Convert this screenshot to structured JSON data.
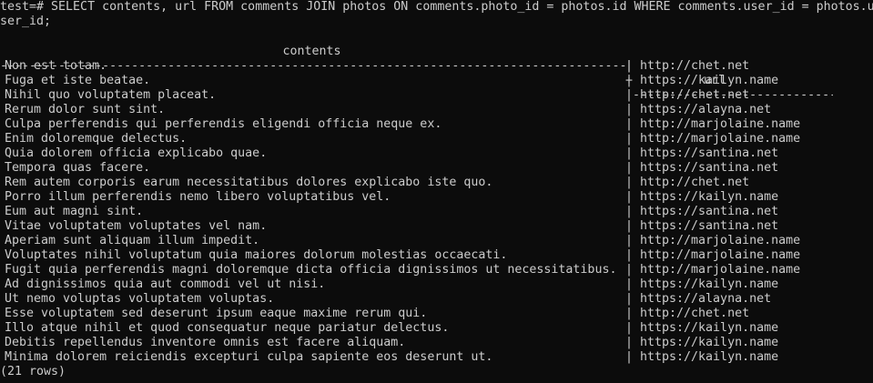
{
  "terminal": {
    "prompt_line_1": "test=# SELECT contents, url FROM comments JOIN photos ON comments.photo_id = photos.id WHERE comments.user_id = photos.u",
    "prompt_line_2": "ser_id;",
    "header": {
      "col1": "contents",
      "col2": "url",
      "sep": "|",
      "dash_left": "--------------------------------------------------------------------------------------------------------",
      "dash_plus": "+",
      "dash_right": "------------------------------------"
    },
    "rows": [
      {
        "contents": "Non est totam.",
        "sep": "|",
        "url": "http://chet.net"
      },
      {
        "contents": "Fuga et iste beatae.",
        "sep": "|",
        "url": "https://kailyn.name"
      },
      {
        "contents": "Nihil quo voluptatem placeat.",
        "sep": "|",
        "url": "http://chet.net"
      },
      {
        "contents": "Rerum dolor sunt sint.",
        "sep": "|",
        "url": "https://alayna.net"
      },
      {
        "contents": "Culpa perferendis qui perferendis eligendi officia neque ex.",
        "sep": "|",
        "url": "http://marjolaine.name"
      },
      {
        "contents": "Enim doloremque delectus.",
        "sep": "|",
        "url": "http://marjolaine.name"
      },
      {
        "contents": "Quia dolorem officia explicabo quae.",
        "sep": "|",
        "url": "https://santina.net"
      },
      {
        "contents": "Tempora quas facere.",
        "sep": "|",
        "url": "https://santina.net"
      },
      {
        "contents": "Rem autem corporis earum necessitatibus dolores explicabo iste quo.",
        "sep": "|",
        "url": "http://chet.net"
      },
      {
        "contents": "Porro illum perferendis nemo libero voluptatibus vel.",
        "sep": "|",
        "url": "https://kailyn.name"
      },
      {
        "contents": "Eum aut magni sint.",
        "sep": "|",
        "url": "https://santina.net"
      },
      {
        "contents": "Vitae voluptatem voluptates vel nam.",
        "sep": "|",
        "url": "https://santina.net"
      },
      {
        "contents": "Aperiam sunt aliquam illum impedit.",
        "sep": "|",
        "url": "http://marjolaine.name"
      },
      {
        "contents": "Voluptates nihil voluptatum quia maiores dolorum molestias occaecati.",
        "sep": "|",
        "url": "http://marjolaine.name"
      },
      {
        "contents": "Fugit quia perferendis magni doloremque dicta officia dignissimos ut necessitatibus.",
        "sep": "|",
        "url": "http://marjolaine.name"
      },
      {
        "contents": "Ad dignissimos quia aut commodi vel ut nisi.",
        "sep": "|",
        "url": "https://kailyn.name"
      },
      {
        "contents": "Ut nemo voluptas voluptatem voluptas.",
        "sep": "|",
        "url": "https://alayna.net"
      },
      {
        "contents": "Esse voluptatem sed deserunt ipsum eaque maxime rerum qui.",
        "sep": "|",
        "url": "http://chet.net"
      },
      {
        "contents": "Illo atque nihil et quod consequatur neque pariatur delectus.",
        "sep": "|",
        "url": "https://kailyn.name"
      },
      {
        "contents": "Debitis repellendus inventore omnis est facere aliquam.",
        "sep": "|",
        "url": "https://kailyn.name"
      },
      {
        "contents": "Minima dolorem reiciendis excepturi culpa sapiente eos deserunt ut.",
        "sep": "|",
        "url": "https://kailyn.name"
      }
    ],
    "row_count": "(21 rows)",
    "colors": {
      "background": "#0c0c0c",
      "text": "#cccccc"
    }
  }
}
